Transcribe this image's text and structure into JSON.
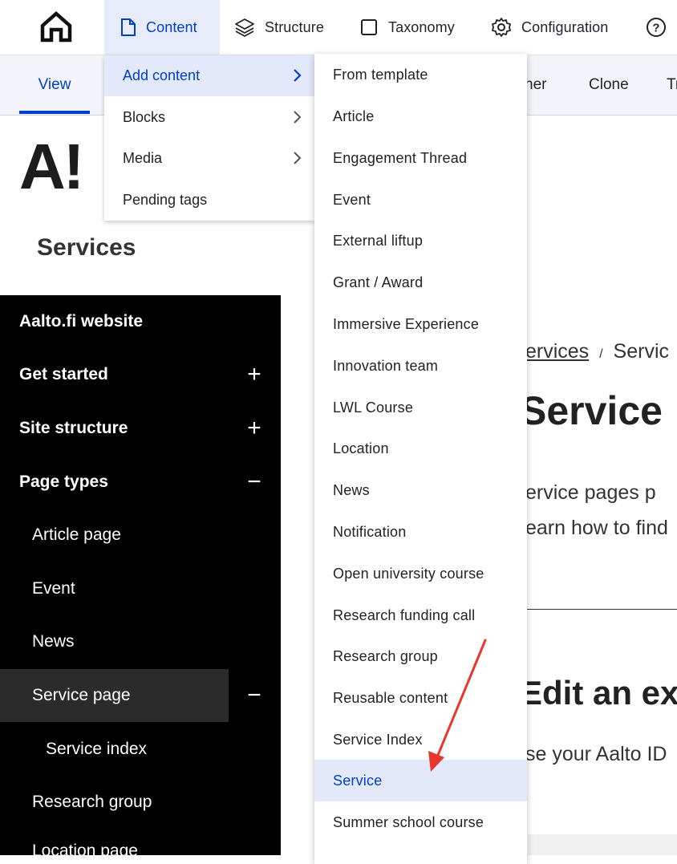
{
  "toolbar": {
    "home_icon": "home-icon",
    "items": [
      {
        "label": "Content",
        "icon": "document-icon"
      },
      {
        "label": "Structure",
        "icon": "layers-icon"
      },
      {
        "label": "Taxonomy",
        "icon": "square-icon"
      },
      {
        "label": "Configuration",
        "icon": "gear-icon"
      }
    ],
    "help_icon": "help-icon"
  },
  "tabs": {
    "view": "View",
    "owner_partial": "ner",
    "clone": "Clone",
    "tr_partial": "Tr"
  },
  "header": {
    "logo": "A!",
    "site_title": "Services",
    "dot": "·"
  },
  "sidebar": {
    "items": [
      {
        "label": "Aalto.fi website",
        "toggle": ""
      },
      {
        "label": "Get started",
        "toggle": "+"
      },
      {
        "label": "Site structure",
        "toggle": "+"
      },
      {
        "label": "Page types",
        "toggle": "−"
      },
      {
        "label": "Article page",
        "toggle": ""
      },
      {
        "label": "Event",
        "toggle": ""
      },
      {
        "label": "News",
        "toggle": ""
      },
      {
        "label": "Service page",
        "toggle": "−"
      },
      {
        "label": "Service index",
        "toggle": ""
      },
      {
        "label": "Research group",
        "toggle": ""
      },
      {
        "label": "Location page",
        "toggle": ""
      }
    ]
  },
  "background": {
    "breadcrumb_link": "ervices",
    "breadcrumb_sep": "/",
    "breadcrumb_current": "Servic",
    "heading": "Service",
    "line1": "ervice pages p",
    "line2": "earn how to find",
    "heading2": "Edit an exi",
    "line3": "se your Aalto ID"
  },
  "menu1": {
    "items": [
      {
        "label": "Add content",
        "has_submenu": true,
        "active": true
      },
      {
        "label": "Blocks",
        "has_submenu": true
      },
      {
        "label": "Media",
        "has_submenu": true
      },
      {
        "label": "Pending tags",
        "has_submenu": false
      }
    ]
  },
  "menu2": {
    "items": [
      "From template",
      "Article",
      "Engagement Thread",
      "Event",
      "External liftup",
      "Grant / Award",
      "Immersive Experience",
      "Innovation team",
      "LWL Course",
      "Location",
      "News",
      "Notification",
      "Open university course",
      "Research funding call",
      "Research group",
      "Reusable content",
      "Service Index",
      "Service",
      "Summer school course"
    ],
    "active_index": 17
  },
  "colors": {
    "accent": "#003ecc",
    "active_bg": "#e4e8fb",
    "sidebar_bg": "#000000",
    "annotation_arrow": "#e8372b"
  }
}
